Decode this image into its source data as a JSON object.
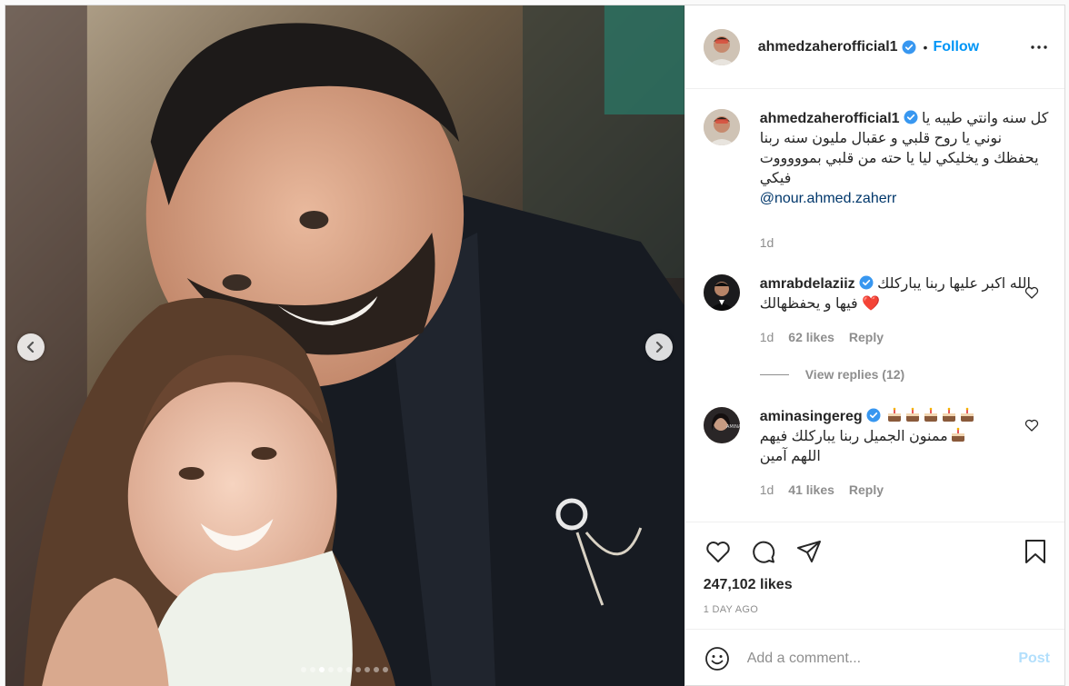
{
  "post": {
    "author": "ahmedzaherofficial1",
    "follow_label": "Follow",
    "separator": "•",
    "media": {
      "slide_count": 10,
      "active_slide": 2
    },
    "caption": {
      "username": "ahmedzaherofficial1",
      "text": "كل سنه وانتي طيبه يا نوني يا روح قلبي و عقبال مليون سنه ربنا يحفظك و يخليكي ليا يا حته من قلبي بموووووت فيكي",
      "mention": "@nour.ahmed.zaherr",
      "time": "1d"
    },
    "comments": [
      {
        "username": "amrabdelaziiz",
        "text": "الله اكبر عليها ربنا يباركلك فيها و يحفظهالك",
        "emoji": "❤️",
        "time": "1d",
        "likes": "62 likes",
        "reply_label": "Reply"
      },
      {
        "username": "aminasingereg",
        "text_line1": "ممنون الجميل ربنا يباركلك فيهم",
        "text_line2": "اللهم آمين",
        "time": "1d",
        "likes": "41 likes",
        "reply_label": "Reply"
      }
    ],
    "view_replies": "View replies (12)",
    "likes": "247,102 likes",
    "posted": "1 DAY AGO",
    "comment_placeholder": "Add a comment...",
    "post_label": "Post",
    "icons": [
      "heart-icon",
      "comment-icon",
      "share-icon",
      "bookmark-icon",
      "emoji-icon",
      "more-options-icon",
      "verified-badge-icon"
    ],
    "colors": {
      "accent": "#0095f6",
      "post_disabled": "#b2dffc",
      "muted": "#8e8e8e",
      "text": "#262626"
    }
  }
}
